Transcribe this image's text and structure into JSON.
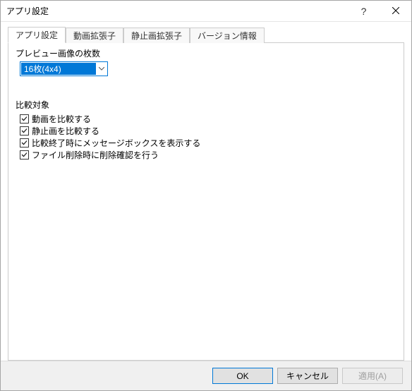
{
  "window": {
    "title": "アプリ設定"
  },
  "tabs": {
    "app_settings": "アプリ設定",
    "video_ext": "動画拡張子",
    "image_ext": "静止画拡張子",
    "version": "バージョン情報"
  },
  "panel": {
    "preview_count_label": "プレビュー画像の枚数",
    "preview_count_value": "16枚(4x4)",
    "compare_label": "比較対象",
    "checkboxes": {
      "compare_video": "動画を比較する",
      "compare_image": "静止画を比較する",
      "show_msgbox": "比較終了時にメッセージボックスを表示する",
      "confirm_delete": "ファイル削除時に削除確認を行う"
    },
    "checked": {
      "compare_video": true,
      "compare_image": true,
      "show_msgbox": true,
      "confirm_delete": true
    }
  },
  "buttons": {
    "ok": "OK",
    "cancel": "キャンセル",
    "apply": "適用(A)"
  }
}
